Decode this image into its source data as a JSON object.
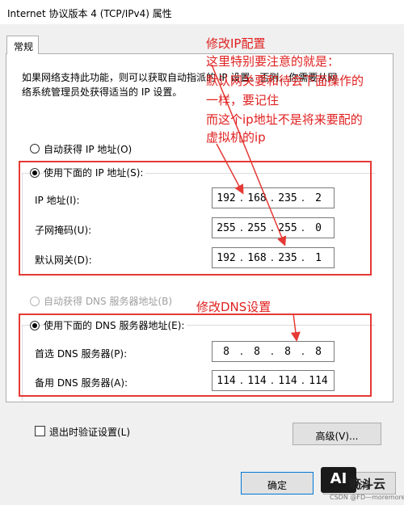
{
  "window": {
    "title": "Internet 协议版本 4 (TCP/IPv4) 属性"
  },
  "tabs": [
    {
      "label": "常规"
    }
  ],
  "description": {
    "line1": "如果网络支持此功能，则可以获取自动指派的 IP 设置。否则，你需要从网",
    "line2": "络系统管理员处获得适当的 IP 设置。"
  },
  "ip_section": {
    "auto_label": "自动获得 IP 地址(O)",
    "manual_label": "使用下面的 IP 地址(S):",
    "fields": [
      {
        "label": "IP 地址(I):",
        "octets": [
          "192",
          "168",
          "235",
          "2"
        ]
      },
      {
        "label": "子网掩码(U):",
        "octets": [
          "255",
          "255",
          "255",
          "0"
        ]
      },
      {
        "label": "默认网关(D):",
        "octets": [
          "192",
          "168",
          "235",
          "1"
        ]
      }
    ]
  },
  "dns_section": {
    "auto_label": "自动获得 DNS 服务器地址(B)",
    "manual_label": "使用下面的 DNS 服务器地址(E):",
    "fields": [
      {
        "label": "首选 DNS 服务器(P):",
        "octets": [
          "8",
          "8",
          "8",
          "8"
        ]
      },
      {
        "label": "备用 DNS 服务器(A):",
        "octets": [
          "114",
          "114",
          "114",
          "114"
        ]
      }
    ]
  },
  "validate_label": "退出时验证设置(L)",
  "advanced_label": "高级(V)...",
  "ok_label": "确定",
  "cancel_label": "取消",
  "annotations": {
    "ip_title": "修改IP配置",
    "note1": "这里特别要注意的就是：",
    "note2": "默认网关要和待会下面操作的",
    "note3": "一样，要记住",
    "note4": "而这个ip地址不是将来要配的",
    "note5": "虚拟机的ip",
    "dns_title": "修改DNS设置"
  },
  "watermark": {
    "logo": "AI",
    "text": "筋斗云",
    "csdn": "CSDN @FD—moremore"
  },
  "colors": {
    "annotation": "#e53935",
    "window_bg": "#f0f0f0"
  }
}
